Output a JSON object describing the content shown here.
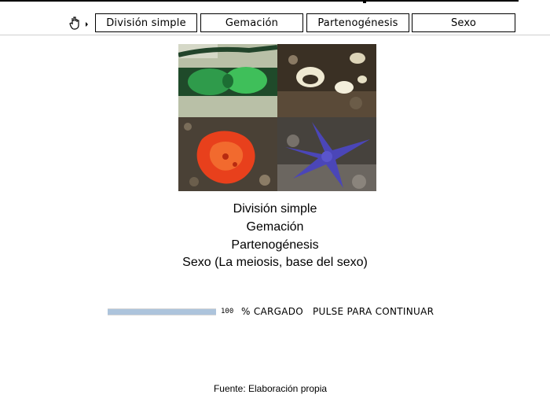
{
  "nav": {
    "tabs": [
      {
        "label": "División simple"
      },
      {
        "label": "Gemación"
      },
      {
        "label": "Partenogénesis"
      },
      {
        "label": "Sexo"
      }
    ],
    "pointer_icon": "hand-pointer-icon"
  },
  "photos": [
    {
      "icon": "cell-division-photo"
    },
    {
      "icon": "larvae-photo"
    },
    {
      "icon": "red-organism-photo"
    },
    {
      "icon": "starfish-photo"
    }
  ],
  "topics": {
    "division": "División simple",
    "gemacion": "Gemación",
    "partenogenesis": "Partenogénesis",
    "sexo": "Sexo (La meiosis, base del sexo)"
  },
  "loader": {
    "progress_value": "100",
    "progress_fraction": 1.0,
    "loaded_label": "% CARGADO",
    "continue_label": "PULSE PARA CONTINUAR",
    "bar_color": "#adc4dc"
  },
  "caption": "Fuente: Elaboración propia"
}
